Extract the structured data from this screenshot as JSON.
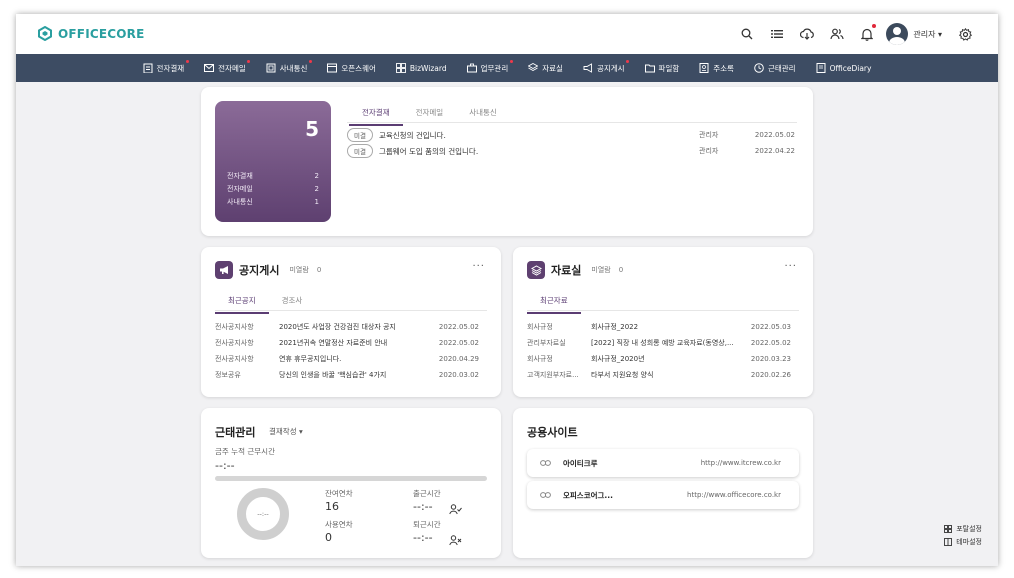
{
  "app": {
    "logo_text": "OFFICECORE",
    "logo_icon": "hexagon-logo-icon"
  },
  "header": {
    "icons": [
      "search-icon",
      "list-icon",
      "cloud-download-icon",
      "users-icon",
      "bell-icon",
      "gear-icon"
    ],
    "user_name": "관리자 ▾"
  },
  "nav": [
    {
      "label": "전자결재",
      "icon": "approval-icon",
      "dot": true
    },
    {
      "label": "전자메일",
      "icon": "mail-icon",
      "dot": true
    },
    {
      "label": "사내통신",
      "icon": "message-icon",
      "dot": true
    },
    {
      "label": "오픈스퀘어",
      "icon": "square-icon",
      "dot": false
    },
    {
      "label": "BizWizard",
      "icon": "grid-icon",
      "dot": false
    },
    {
      "label": "업무관리",
      "icon": "briefcase-icon",
      "dot": true
    },
    {
      "label": "자료실",
      "icon": "layers-icon",
      "dot": false
    },
    {
      "label": "공지게시",
      "icon": "megaphone-icon",
      "dot": true
    },
    {
      "label": "파일함",
      "icon": "folder-icon",
      "dot": false
    },
    {
      "label": "주소록",
      "icon": "addressbook-icon",
      "dot": false
    },
    {
      "label": "근태관리",
      "icon": "clock-icon",
      "dot": false
    },
    {
      "label": "OfficeDiary",
      "icon": "diary-icon",
      "dot": false
    }
  ],
  "summary": {
    "total": "5",
    "rows": [
      {
        "label": "전자결재",
        "count": "2"
      },
      {
        "label": "전자메일",
        "count": "2"
      },
      {
        "label": "사내통신",
        "count": "1"
      }
    ],
    "tabs": [
      "전자결재",
      "전자메일",
      "사내통신"
    ],
    "items": [
      {
        "status": "미결",
        "subject": "교육신청의 건입니다.",
        "author": "관리자",
        "date": "2022.05.02"
      },
      {
        "status": "미결",
        "subject": "그룹웨어 도입 품의의 건입니다.",
        "author": "관리자",
        "date": "2022.04.22"
      }
    ]
  },
  "notice": {
    "title": "공지게시",
    "unread_label": "미열람",
    "unread_count": "0",
    "more": "···",
    "tabs": [
      "최근공지",
      "경조사"
    ],
    "rows": [
      {
        "category": "전사공지사항",
        "title": "2020년도 사업장 건강검진 대상자 공지",
        "date": "2022.05.02"
      },
      {
        "category": "전사공지사항",
        "title": "2021년귀속 연말정산 자료준비 안내",
        "date": "2022.05.02"
      },
      {
        "category": "전사공지사항",
        "title": "연휴 휴무공지입니다.",
        "date": "2020.04.29"
      },
      {
        "category": "정보공유",
        "title": "당신의 인생을 바꿀 '핵심습관' 4가지",
        "date": "2020.03.02"
      }
    ]
  },
  "library": {
    "title": "자료실",
    "unread_label": "미열람",
    "unread_count": "0",
    "more": "···",
    "tabs": [
      "최근자료"
    ],
    "rows": [
      {
        "category": "회사규정",
        "title": "회사규정_2022",
        "date": "2022.05.03"
      },
      {
        "category": "관리부자료실",
        "title": "[2022] 직장 내 성희롱 예방 교육자료(동영상,...",
        "date": "2022.05.02"
      },
      {
        "category": "회사규정",
        "title": "회사규정_2020년",
        "date": "2020.03.23"
      },
      {
        "category": "고객지원부자료...",
        "title": "타부서 지원요청 양식",
        "date": "2020.02.26"
      }
    ]
  },
  "attendance": {
    "title": "근태관리",
    "mode": "결재작성 ▾",
    "weekly_label": "금주 누적 근무시간",
    "weekly_value": "--:--",
    "donut_value": "--:--",
    "remaining_label": "잔여연차",
    "remaining_value": "16",
    "used_label": "사용연차",
    "used_value": "0",
    "checkin_label": "출근시간",
    "checkin_value": "--:--",
    "checkout_label": "퇴근시간",
    "checkout_value": "--:--"
  },
  "sites": {
    "title": "공용사이트",
    "rows": [
      {
        "name": "아이티크루",
        "url": "http://www.itcrew.co.kr"
      },
      {
        "name": "오피스코어그...",
        "url": "http://www.officecore.co.kr"
      }
    ]
  },
  "side_links": [
    {
      "label": "포탈설정",
      "icon": "grid-icon"
    },
    {
      "label": "테마설정",
      "icon": "theme-icon"
    }
  ]
}
